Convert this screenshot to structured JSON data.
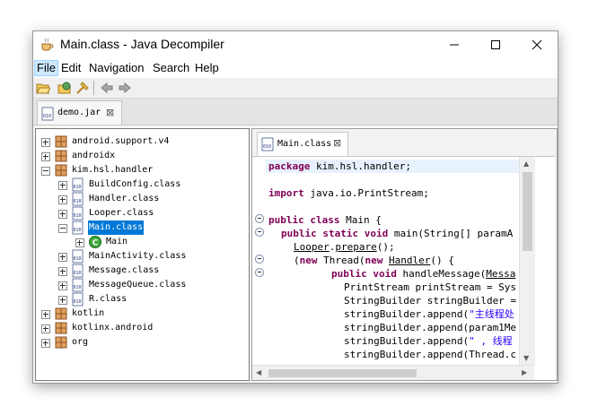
{
  "window": {
    "title": "Main.class - Java Decompiler",
    "controls": [
      "minimize",
      "maximize",
      "close"
    ]
  },
  "menu": [
    "File",
    "Edit",
    "Navigation",
    "Search",
    "Help"
  ],
  "toolbar": {
    "icons": [
      "open-file-icon",
      "open-type-icon",
      "search-icon",
      "back-arrow-icon",
      "forward-arrow-icon"
    ]
  },
  "outer_tab": {
    "label": "demo.jar",
    "close": "⊠"
  },
  "tree": [
    {
      "label": "android.support.v4",
      "type": "package",
      "expander": "plus"
    },
    {
      "label": "androidx",
      "type": "package",
      "expander": "plus"
    },
    {
      "label": "kim.hsl.handler",
      "type": "package",
      "expander": "minus"
    },
    {
      "label": "BuildConfig.class",
      "type": "class",
      "expander": "plus"
    },
    {
      "label": "Handler.class",
      "type": "class",
      "expander": "plus"
    },
    {
      "label": "Looper.class",
      "type": "class",
      "expander": "plus"
    },
    {
      "label": "Main.class",
      "type": "class",
      "expander": "minus",
      "selected": true
    },
    {
      "label": "Main",
      "type": "type",
      "expander": "plus"
    },
    {
      "label": "MainActivity.class",
      "type": "class",
      "expander": "plus"
    },
    {
      "label": "Message.class",
      "type": "class",
      "expander": "plus"
    },
    {
      "label": "MessageQueue.class",
      "type": "class",
      "expander": "plus"
    },
    {
      "label": "R.class",
      "type": "class",
      "expander": "plus"
    },
    {
      "label": "kotlin",
      "type": "package",
      "expander": "plus"
    },
    {
      "label": "kotlinx.android",
      "type": "package",
      "expander": "plus"
    },
    {
      "label": "org",
      "type": "package",
      "expander": "plus"
    }
  ],
  "editor": {
    "tab_label": "Main.class",
    "tab_close": "⊠",
    "code": {
      "l1_kw": "package",
      "l1_rest": " kim.hsl.handler;",
      "l2_kw": "import",
      "l2_rest": " java.io.PrintStream;",
      "l3_kw": "public class",
      "l3_rest": " Main {",
      "l4_kw": "public static void",
      "l4_rest": " main(String[] paramA",
      "l5_u1": "Looper",
      "l5_dot": ".",
      "l5_u2": "prepare",
      "l5_rest": "();",
      "l6_a": "(",
      "l6_kw1": "new",
      "l6_b": " Thread(",
      "l6_kw2": "new",
      "l6_c": " ",
      "l6_u": "Handler",
      "l6_d": "() {",
      "l7_kw": "public void",
      "l7_a": " handleMessage(",
      "l7_u": "Messa",
      "l8": "PrintStream printStream = Sys",
      "l9": "StringBuilder stringBuilder =",
      "l10": "stringBuilder.append(",
      "l10_str": "\"主线程处",
      "l11": "stringBuilder.append(param1Me",
      "l12": "stringBuilder.append(",
      "l12_str": "\" , 线程",
      "l13": "stringBuilder.append(Thread.c"
    }
  }
}
